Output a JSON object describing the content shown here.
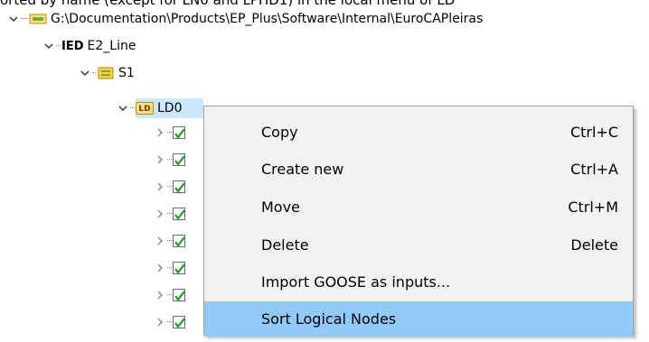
{
  "caption": "orted by name (except for LN0 and LPHD1) in the local menu of LD",
  "tree": {
    "project_path": "G:\\Documentation\\Products\\EP_Plus\\Software\\Internal\\EuroCAPleiras",
    "ied": {
      "type_label": "IED",
      "name": "E2_Line"
    },
    "station": {
      "name": "S1"
    },
    "ld": {
      "icon_text": "LD",
      "name": "LD0"
    },
    "child_nodes_count": 8
  },
  "context_menu": {
    "items": [
      {
        "label": "Copy",
        "shortcut": "Ctrl+C",
        "state": "normal"
      },
      {
        "label": "Create new",
        "shortcut": "Ctrl+A",
        "state": "normal"
      },
      {
        "label": "Move",
        "shortcut": "Ctrl+M",
        "state": "normal"
      },
      {
        "label": "Delete",
        "shortcut": "Delete",
        "state": "normal"
      },
      {
        "label": "Import GOOSE as inputs...",
        "shortcut": "",
        "state": "normal"
      },
      {
        "label": "Sort Logical Nodes",
        "shortcut": "",
        "state": "highlighted"
      }
    ]
  },
  "colors": {
    "selection": "#cce8ff",
    "menu_highlight": "#91c9f7",
    "menu_background": "#f2f2f2",
    "checkmark": "#1a9c1a"
  }
}
